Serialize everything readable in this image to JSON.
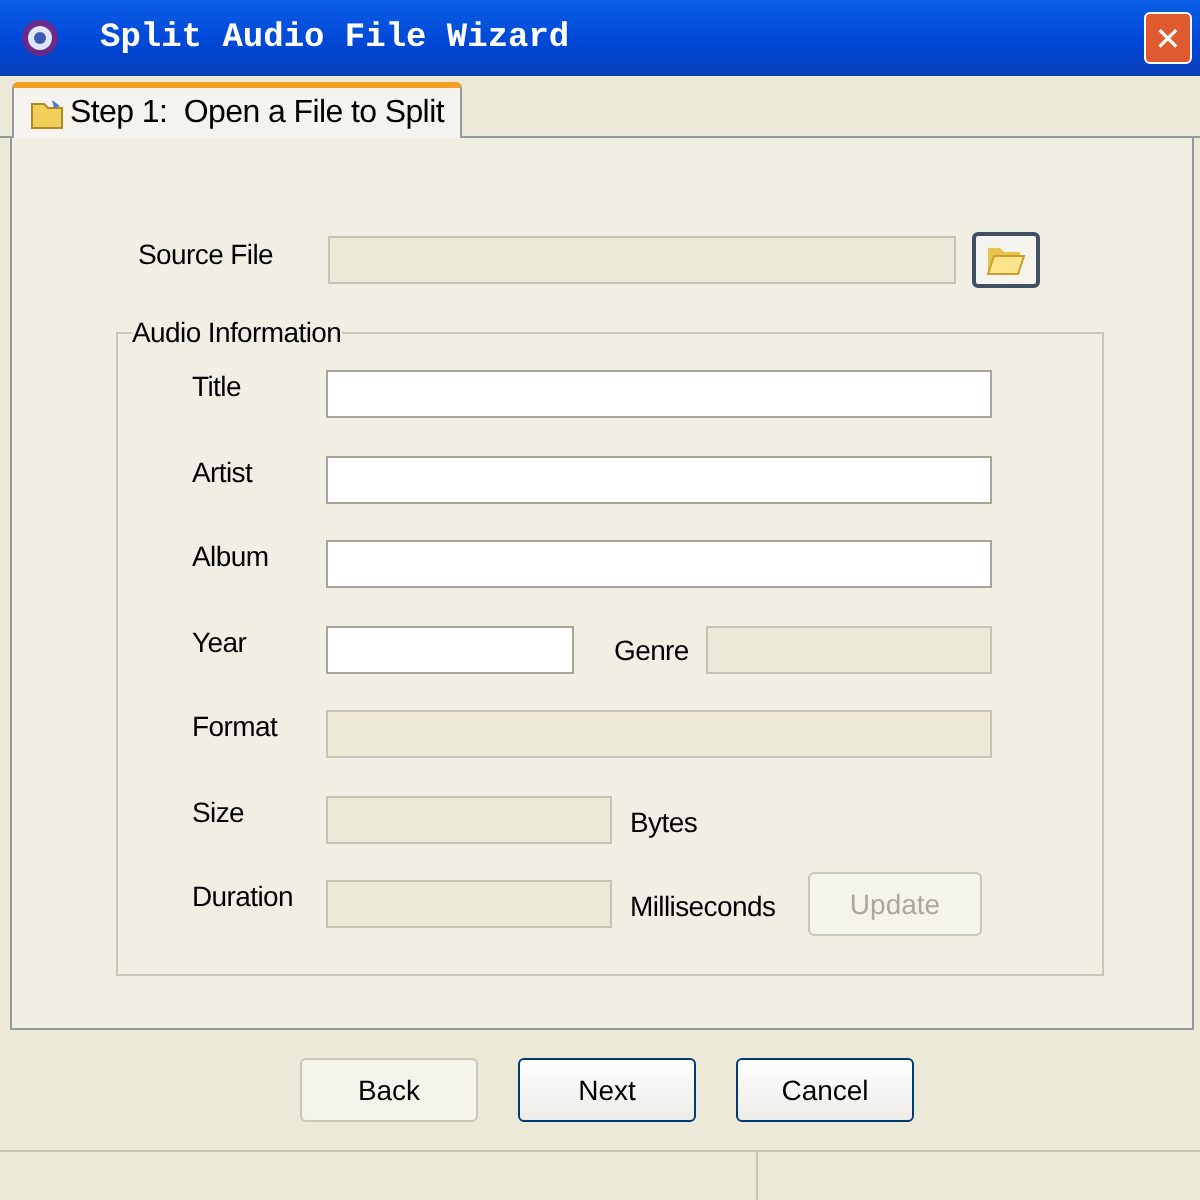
{
  "window": {
    "title": "Split Audio File Wizard",
    "close": "✕"
  },
  "tabs": [
    {
      "label": "Step 1:  Open a File to Split",
      "selected": true
    }
  ],
  "source": {
    "label": "Source File",
    "disabled": true
  },
  "group": {
    "legend": "Audio Information",
    "rows": [
      {
        "kind": "full",
        "label": "Title",
        "disabled": false
      },
      {
        "kind": "full",
        "label": "Artist",
        "disabled": false
      },
      {
        "kind": "full",
        "label": "Album",
        "disabled": false
      },
      {
        "kind": "pair",
        "label": "Year",
        "disabled": false,
        "label2": "Genre",
        "disabled2": true
      },
      {
        "kind": "full",
        "label": "Format",
        "disabled": true
      },
      {
        "kind": "unit",
        "label": "Size",
        "disabled": true,
        "unit": "Bytes"
      },
      {
        "kind": "unit",
        "label": "Duration",
        "disabled": true,
        "unit": "Milliseconds",
        "button": {
          "label": "Update",
          "disabled": true
        }
      }
    ]
  },
  "buttons": [
    {
      "label": "Back",
      "disabled": true
    },
    {
      "label": "Next",
      "disabled": false
    },
    {
      "label": "Cancel",
      "disabled": false
    }
  ]
}
